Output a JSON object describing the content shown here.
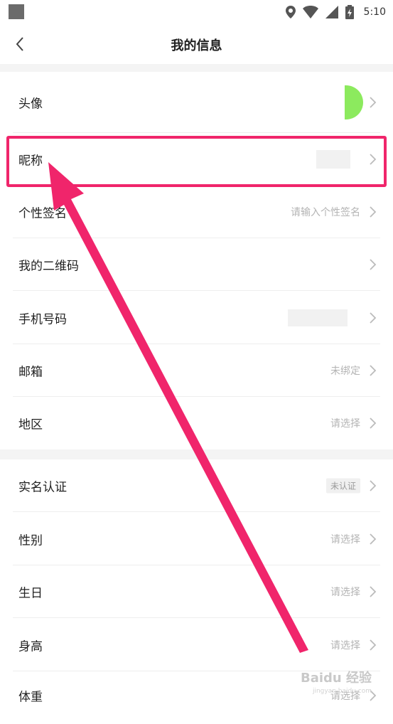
{
  "status_bar": {
    "time": "5:10"
  },
  "header": {
    "title": "我的信息"
  },
  "rows_group1": [
    {
      "label": "头像",
      "value": ""
    },
    {
      "label": "昵称",
      "value": ""
    },
    {
      "label": "个性签名",
      "value": "请输入个性签名"
    },
    {
      "label": "我的二维码",
      "value": ""
    },
    {
      "label": "手机号码",
      "value": ""
    },
    {
      "label": "邮箱",
      "value": "未绑定"
    },
    {
      "label": "地区",
      "value": "请选择"
    }
  ],
  "rows_group2": [
    {
      "label": "实名认证",
      "badge": "未认证"
    },
    {
      "label": "性别",
      "value": "请选择"
    },
    {
      "label": "生日",
      "value": "请选择"
    },
    {
      "label": "身高",
      "value": "请选择"
    },
    {
      "label": "体重",
      "value": "请选择"
    }
  ],
  "colors": {
    "accent": "#f0256b",
    "avatar_green": "#8cea5e"
  },
  "watermark": {
    "text": "Baidu 经验",
    "sub": "jingyan.baidu.com"
  }
}
